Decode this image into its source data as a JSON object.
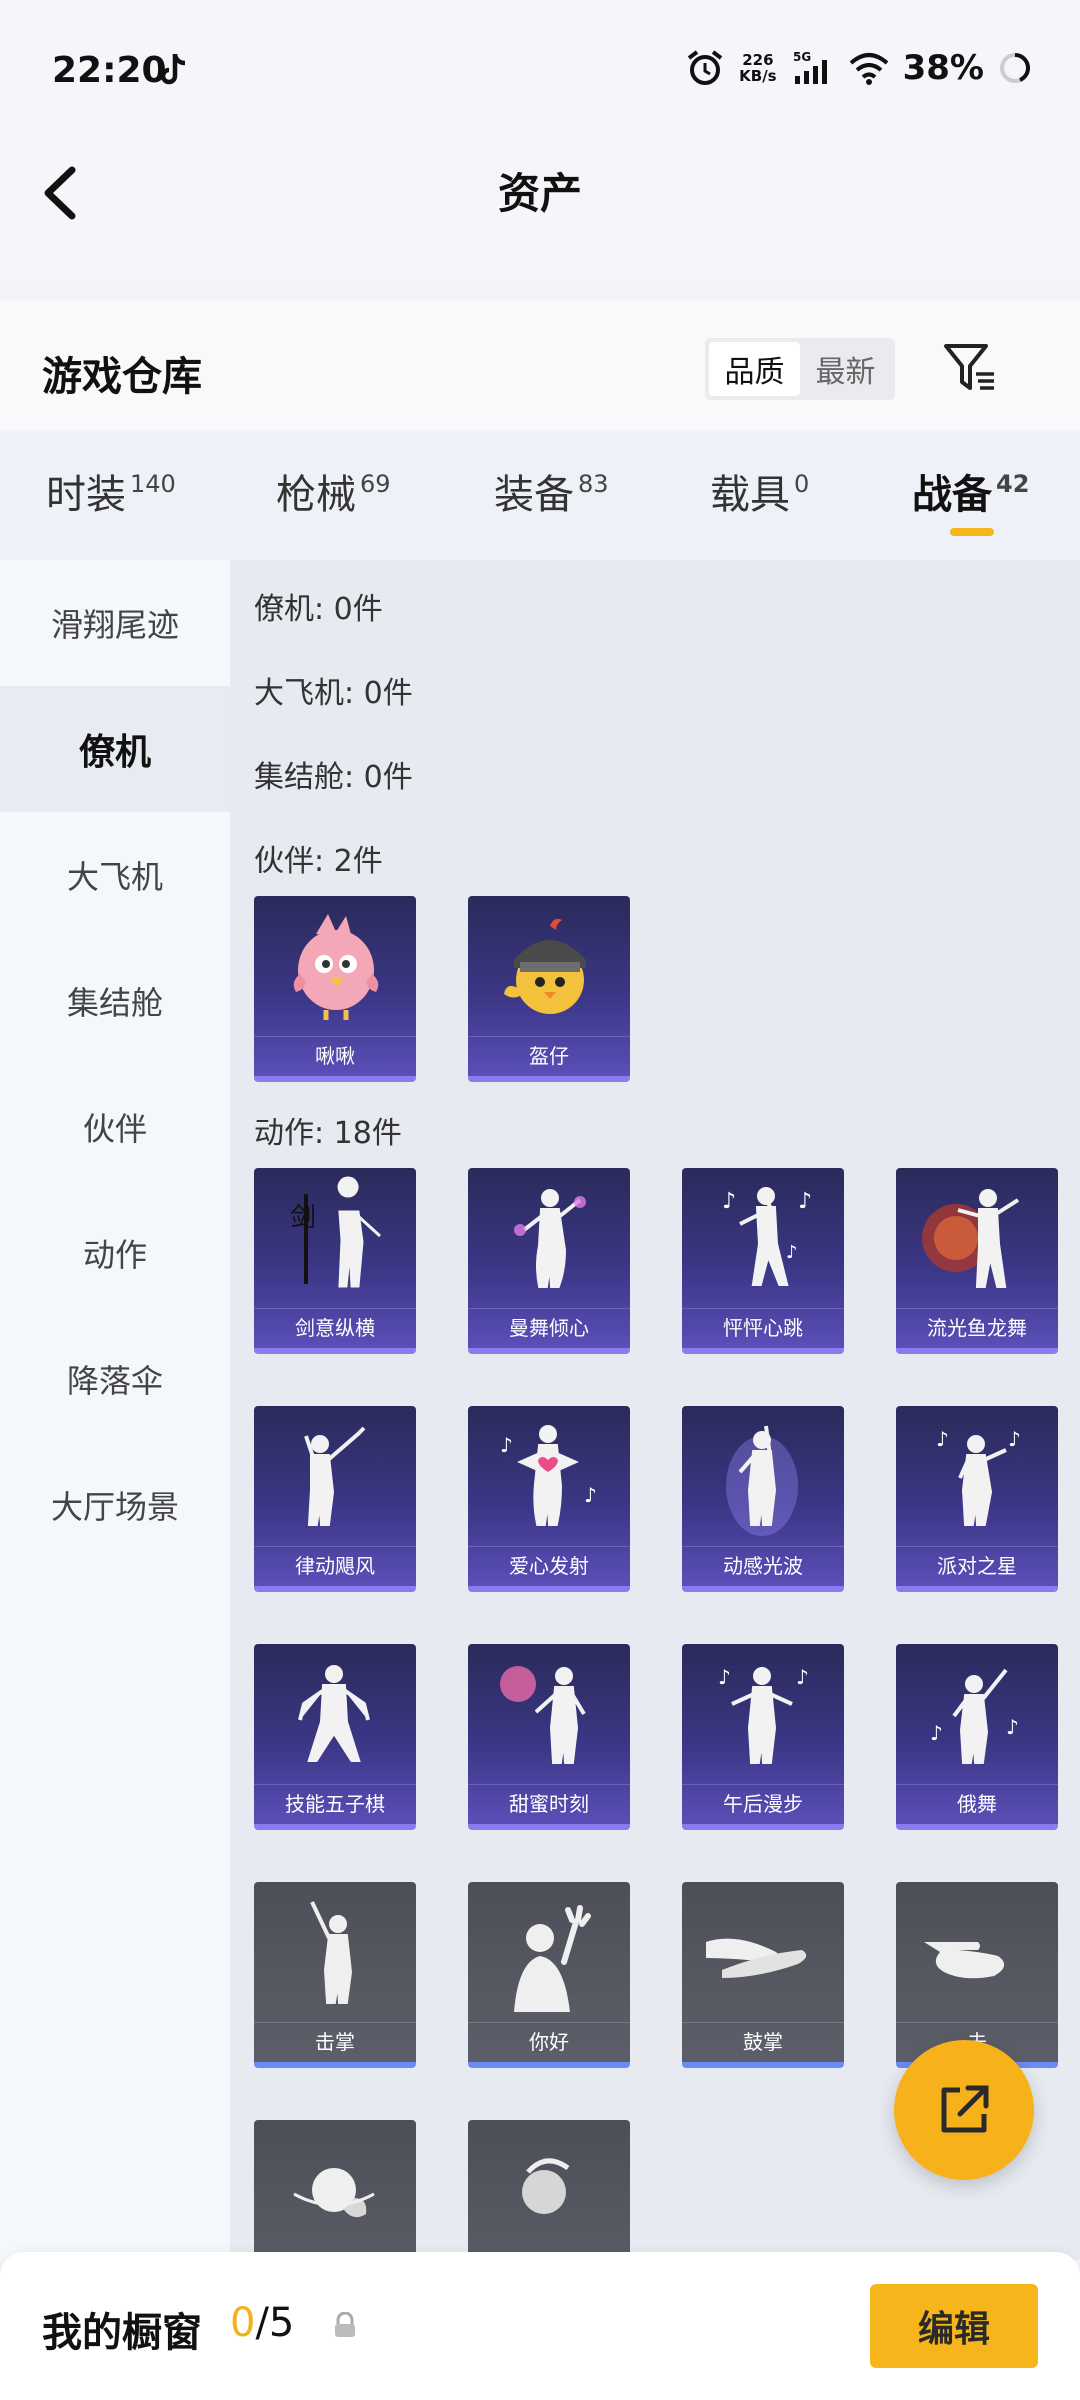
{
  "status_bar": {
    "time": "22:20",
    "speed_value": "226",
    "speed_unit": "KB/s",
    "network": "5G",
    "battery": "38%"
  },
  "header": {
    "title": "资产"
  },
  "warehouse": {
    "title": "游戏仓库",
    "sort": {
      "options": [
        "品质",
        "最新"
      ],
      "selected": "品质"
    }
  },
  "tabs": [
    {
      "label": "时装",
      "count": "140"
    },
    {
      "label": "枪械",
      "count": "69"
    },
    {
      "label": "装备",
      "count": "83"
    },
    {
      "label": "载具",
      "count": "0"
    },
    {
      "label": "战备",
      "count": "42",
      "active": true
    }
  ],
  "sidebar": {
    "items": [
      "滑翔尾迹",
      "僚机",
      "大飞机",
      "集结舱",
      "伙伴",
      "动作",
      "降落伞",
      "大厅场景"
    ],
    "selected": "僚机"
  },
  "sections": {
    "wingman": "僚机: 0件",
    "big_plane": "大飞机: 0件",
    "rally_pod": "集结舱: 0件",
    "partner": "伙伴: 2件",
    "emote": "动作: 18件"
  },
  "partners": [
    "啾啾",
    "盔仔"
  ],
  "emotes_purple": [
    "剑意纵横",
    "曼舞倾心",
    "怦怦心跳",
    "流光鱼龙舞",
    "律动飓风",
    "爱心发射",
    "动感光波",
    "派对之星",
    "技能五子棋",
    "甜蜜时刻",
    "午后漫步",
    "俄舞"
  ],
  "emotes_gray": [
    "击掌",
    "你好",
    "鼓掌",
    "去",
    "",
    ""
  ],
  "bottom_bar": {
    "title": "我的橱窗",
    "count_current": "0",
    "count_total": "/5",
    "edit_label": "编辑"
  },
  "colors": {
    "accent": "#f5b51b",
    "card_purple": "#3b3685",
    "card_gray": "#5c5e69"
  }
}
